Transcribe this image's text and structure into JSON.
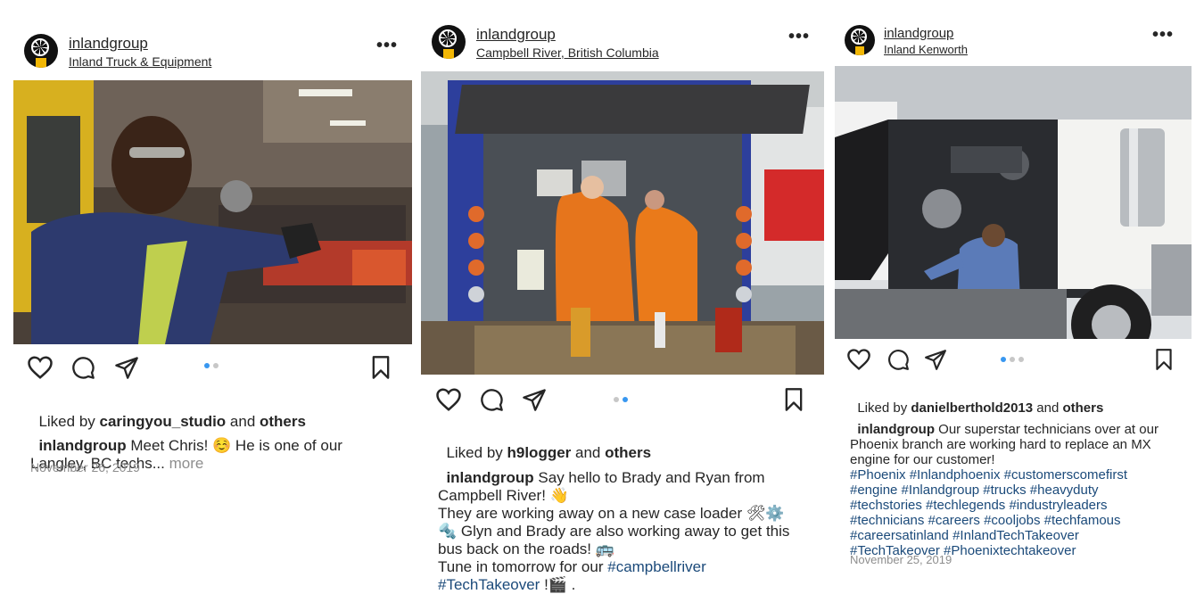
{
  "posts": [
    {
      "username": "inlandgroup",
      "location": "Inland Truck & Equipment",
      "liked_prefix": "Liked by ",
      "liked_user": "caringyou_studio",
      "liked_mid": " and ",
      "liked_others": "others",
      "caption_user": "inlandgroup",
      "caption_line1": " Meet Chris! ☺️ He is one of our",
      "caption_line2": "Langley, BC techs...",
      "more_label": " more",
      "date": "November 26, 2019",
      "carousel": {
        "count": 2,
        "active": 1
      }
    },
    {
      "username": "inlandgroup",
      "location": "Campbell River, British Columbia",
      "liked_prefix": "Liked by ",
      "liked_user": "h9logger",
      "liked_mid": " and ",
      "liked_others": "others",
      "caption_user": "inlandgroup",
      "caption_line1": " Say hello to Brady and Ryan from",
      "caption_line2": "Campbell River! 👋",
      "caption_line3": "They are working away on a new case loader 🛠⚙️",
      "caption_line4": "🔩 Glyn and Brady are also working away to get this",
      "caption_line5": "bus back on the roads! 🚌",
      "caption_line6": "Tune in tomorrow for our ",
      "hashtag1": "#campbellriver",
      "hashtag2": "#TechTakeover",
      "caption_tail": " !🎬 .",
      "carousel": {
        "count": 2,
        "active": 2
      }
    },
    {
      "username": "inlandgroup",
      "location": "Inland Kenworth",
      "liked_prefix": "Liked by ",
      "liked_user": "danielberthold2013",
      "liked_mid": " and ",
      "liked_others": "others",
      "caption_user": "inlandgroup",
      "caption_line1": " Our superstar technicians over at our",
      "caption_line2": "Phoenix branch are working hard to replace an MX",
      "caption_line3": "engine for our customer!",
      "hashtag_lines": [
        "#Phoenix #Inlandphoenix #customerscomefirst",
        "#engine #Inlandgroup #trucks #heavyduty",
        "#techstories #techlegends #industryleaders",
        "#technicians #careers #cooljobs #techfamous",
        "#careersatinland #InlandTechTakeover",
        "#TechTakeover #Phoenixtechtakeover"
      ],
      "date": "November 25, 2019",
      "carousel": {
        "count": 3,
        "active": 1
      }
    }
  ],
  "icons": {
    "like": "heart-icon",
    "comment": "comment-icon",
    "share": "send-icon",
    "save": "bookmark-icon",
    "options": "more-options-icon"
  },
  "colors": {
    "text": "#262626",
    "muted": "#8e8e8e",
    "carousel_active": "#3897f0",
    "hashtag": "#1b4a7a",
    "brand_yellow": "#f2b705"
  }
}
